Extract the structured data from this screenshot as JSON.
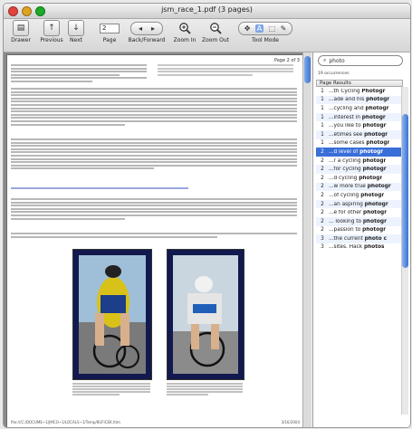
{
  "window": {
    "title": "jsm_race_1.pdf (3 pages)"
  },
  "toolbar": {
    "drawer_label": "Drawer",
    "previous_label": "Previous",
    "next_label": "Next",
    "page_label": "Page",
    "page_value": "2",
    "back_forward_label": "Back/Forward",
    "zoom_in_label": "Zoom In",
    "zoom_out_label": "Zoom Out",
    "tool_mode_label": "Tool Mode"
  },
  "document": {
    "page_indicator": "Page 2 of 3",
    "footer_path": "file:///C:/DOCUME~1/JMCO~1/LOCALS~1/Temp/6UFICEK.htm",
    "footer_date": "3/16/2004"
  },
  "drawer": {
    "search_value": "photo",
    "occurrences": "19 occurrences",
    "columns": [
      "Page",
      "Results"
    ],
    "results": [
      {
        "page": "1",
        "text": "...th Cycling ",
        "hit": "Photogr"
      },
      {
        "page": "1",
        "text": "...ade and his ",
        "hit": "photogr"
      },
      {
        "page": "1",
        "text": "...cycling and ",
        "hit": "photogr"
      },
      {
        "page": "1",
        "text": "...interest in ",
        "hit": "photogr"
      },
      {
        "page": "1",
        "text": "...you like to ",
        "hit": "photogr"
      },
      {
        "page": "1",
        "text": "...etimes see ",
        "hit": "photogr"
      },
      {
        "page": "1",
        "text": "...some cases ",
        "hit": "photogr"
      },
      {
        "page": "2",
        "text": "...d level of ",
        "hit": "photogr"
      },
      {
        "page": "2",
        "text": "...r a cycling ",
        "hit": "photogr"
      },
      {
        "page": "2",
        "text": "...for cycling ",
        "hit": "photogr"
      },
      {
        "page": "2",
        "text": "...d cycling ",
        "hit": "photogr"
      },
      {
        "page": "2",
        "text": "...w more true ",
        "hit": "photogr"
      },
      {
        "page": "2",
        "text": "...of cycling ",
        "hit": "photogr"
      },
      {
        "page": "2",
        "text": "...an aspiring ",
        "hit": "photogr"
      },
      {
        "page": "2",
        "text": "...e for other ",
        "hit": "photogr"
      },
      {
        "page": "2",
        "text": "... looking to ",
        "hit": "photogr"
      },
      {
        "page": "2",
        "text": "...passion to ",
        "hit": "photogr"
      },
      {
        "page": "3",
        "text": "...the current ",
        "hit": "photo c"
      },
      {
        "page": "3",
        "text": "...sites. Hack ",
        "hit": "photos"
      }
    ],
    "selected_index": 7
  }
}
